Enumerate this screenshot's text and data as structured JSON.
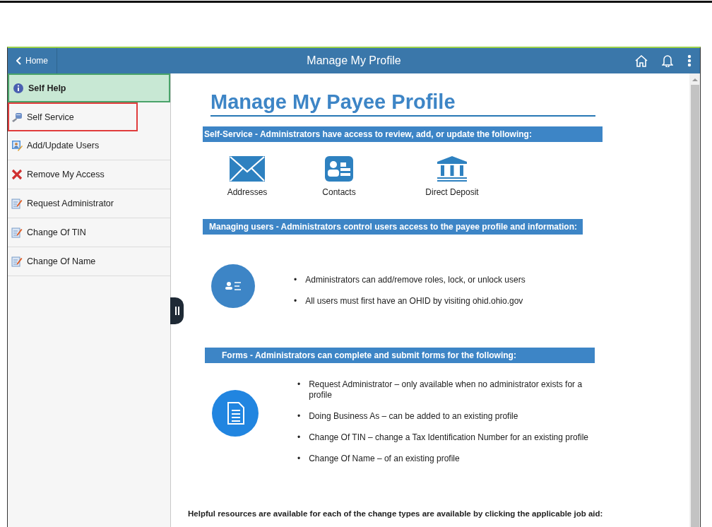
{
  "header": {
    "back_label": "Home",
    "title": "Manage My Profile"
  },
  "sidebar": {
    "items": [
      {
        "label": "Self Help",
        "kind": "info",
        "selected": true,
        "highlighted": false
      },
      {
        "label": "Self Service",
        "kind": "service",
        "selected": false,
        "highlighted": true
      },
      {
        "label": "Add/Update Users",
        "kind": "users",
        "selected": false,
        "highlighted": false
      },
      {
        "label": "Remove My Access",
        "kind": "remove",
        "selected": false,
        "highlighted": false
      },
      {
        "label": "Request Administrator",
        "kind": "form",
        "selected": false,
        "highlighted": false
      },
      {
        "label": "Change Of TIN",
        "kind": "form",
        "selected": false,
        "highlighted": false
      },
      {
        "label": "Change Of Name",
        "kind": "form",
        "selected": false,
        "highlighted": false
      }
    ]
  },
  "content": {
    "title": "Manage My Payee Profile",
    "self_service": {
      "banner": "Self-Service - Administrators have access to review, add, or update the following:",
      "items": [
        {
          "label": "Addresses",
          "kind": "envelope"
        },
        {
          "label": "Contacts",
          "kind": "card"
        },
        {
          "label": "Direct Deposit",
          "kind": "bank"
        }
      ]
    },
    "managing_users": {
      "banner": "Managing users - Administrators control users access to the payee profile and information:",
      "bullets": [
        {
          "marker": "•",
          "text": "Administrators can add/remove roles, lock, or unlock users"
        },
        {
          "marker": "•",
          "text": "All users must first have an OHID by visiting ohid.ohio.gov"
        }
      ]
    },
    "forms": {
      "banner": "Forms - Administrators can complete and submit forms for the following:",
      "bullets": [
        {
          "marker": "•",
          "text": "Request Administrator – only available when no administrator exists for a profile"
        },
        {
          "marker": "•",
          "text": "Doing Business As – can be added to an existing profile"
        },
        {
          "marker": "•",
          "text": "Change Of TIN – change a Tax Identification Number for an existing profile"
        },
        {
          "marker": "•",
          "text": "Change Of Name – of an existing profile"
        }
      ]
    },
    "footer_note": "Helpful resources are available for each of the change types are available by clicking the applicable job aid:"
  }
}
